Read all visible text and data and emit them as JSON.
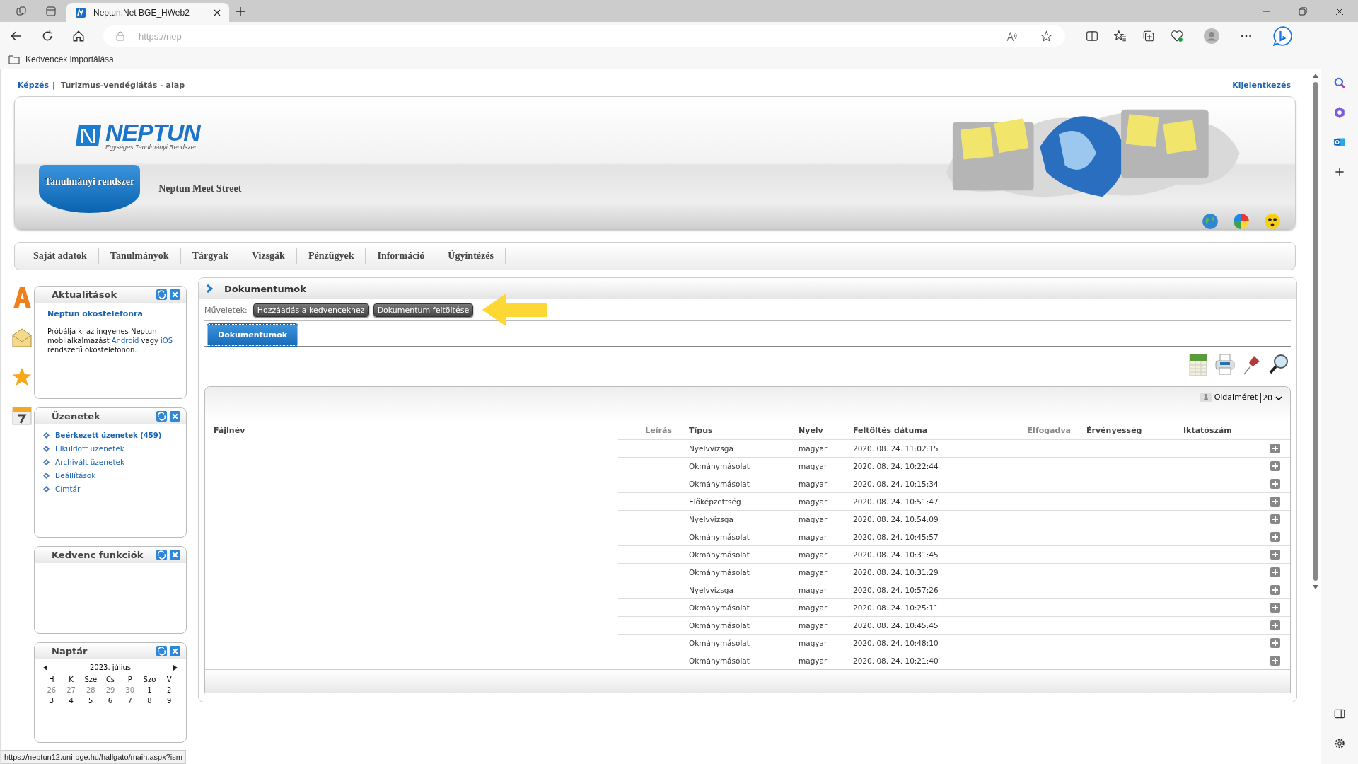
{
  "browser": {
    "tabs": [
      {
        "title": "Neptun.Net BGE_HWeb2",
        "selected": true
      }
    ],
    "url": "https://nep",
    "favorites": [
      "Kedvencek importálása"
    ],
    "status_url": "https://neptun12.uni-bge.hu/hallgato/main.aspx?ism"
  },
  "breadcrumb": {
    "label": "Képzés",
    "separator": "|",
    "program": "Turizmus-vendéglátás - alap"
  },
  "logout": "Kijelentkezés",
  "logo": {
    "name": "NEPTUN",
    "subtitle": "Egységes Tanulmányi Rendszer"
  },
  "system_tabs": [
    {
      "label": "Tanulmányi rendszer",
      "selected": true
    },
    {
      "label": "Neptun Meet Street",
      "selected": false
    }
  ],
  "menu": [
    "Saját adatok",
    "Tanulmányok",
    "Tárgyak",
    "Vizsgák",
    "Pénzügyek",
    "Információ",
    "Ügyintézés"
  ],
  "news": {
    "title": "Aktualitások",
    "headline": "Neptun okostelefonra",
    "parts": [
      {
        "kind": "text",
        "text": "Próbálja ki az ingyenes Neptun mobilalkalmazást "
      },
      {
        "kind": "link",
        "text": "Android"
      },
      {
        "kind": "text",
        "text": " vagy "
      },
      {
        "kind": "link",
        "text": "iOS"
      },
      {
        "kind": "text",
        "text": " rendszerű okostelefonon."
      }
    ]
  },
  "messages": {
    "title": "Üzenetek",
    "items": [
      {
        "label": "Beérkezett üzenetek (459)",
        "highlighted": true
      },
      {
        "label": "Elküldött üzenetek",
        "highlighted": false
      },
      {
        "label": "Archivált üzenetek",
        "highlighted": false
      },
      {
        "label": "Beállítások",
        "highlighted": false
      },
      {
        "label": "Címtár",
        "highlighted": false
      }
    ]
  },
  "favorite_functions": {
    "title": "Kedvenc funkciók"
  },
  "calendar": {
    "title": "Naptár",
    "month": "2023. július",
    "weekdays": [
      "H",
      "K",
      "Sze",
      "Cs",
      "P",
      "Szo",
      "V"
    ],
    "weeks": [
      [
        {
          "day": "26",
          "other_month": true
        },
        {
          "day": "27",
          "other_month": true
        },
        {
          "day": "28",
          "other_month": true
        },
        {
          "day": "29",
          "other_month": true
        },
        {
          "day": "30",
          "other_month": true
        },
        {
          "day": "1",
          "other_month": false
        },
        {
          "day": "2",
          "other_month": false
        }
      ],
      [
        {
          "day": "3",
          "other_month": false
        },
        {
          "day": "4",
          "other_month": false
        },
        {
          "day": "5",
          "other_month": false
        },
        {
          "day": "6",
          "other_month": false
        },
        {
          "day": "7",
          "other_month": false
        },
        {
          "day": "8",
          "other_month": false
        },
        {
          "day": "9",
          "other_month": false
        }
      ]
    ]
  },
  "documents": {
    "title": "Dokumentumok",
    "actions_label": "Műveletek:",
    "actions": [
      "Hozzáadás a kedvencekhez",
      "Dokumentum feltöltése"
    ],
    "tabs": [
      {
        "label": "Dokumentumok",
        "selected": true
      }
    ],
    "pager": {
      "page": "1",
      "size_label": "Oldalméret",
      "size": "20"
    },
    "columns": [
      {
        "label": "Fájlnév",
        "dimmed": false
      },
      {
        "label": "Leírás",
        "dimmed": true
      },
      {
        "label": "Típus",
        "dimmed": false
      },
      {
        "label": "Nyelv",
        "dimmed": false
      },
      {
        "label": "Feltöltés dátuma",
        "dimmed": false
      },
      {
        "label": "Elfogadva",
        "dimmed": true
      },
      {
        "label": "Érvényesség",
        "dimmed": false
      },
      {
        "label": "Iktatószám",
        "dimmed": false
      }
    ],
    "rows": [
      {
        "type": "Nyelvvizsga",
        "language": "magyar",
        "date": "2020. 08. 24. 11:02:15"
      },
      {
        "type": "Okmánymásolat",
        "language": "magyar",
        "date": "2020. 08. 24. 10:22:44"
      },
      {
        "type": "Okmánymásolat",
        "language": "magyar",
        "date": "2020. 08. 24. 10:15:34"
      },
      {
        "type": "Előképzettség",
        "language": "magyar",
        "date": "2020. 08. 24. 10:51:47"
      },
      {
        "type": "Nyelvvizsga",
        "language": "magyar",
        "date": "2020. 08. 24. 10:54:09"
      },
      {
        "type": "Okmánymásolat",
        "language": "magyar",
        "date": "2020. 08. 24. 10:45:57"
      },
      {
        "type": "Okmánymásolat",
        "language": "magyar",
        "date": "2020. 08. 24. 10:31:45"
      },
      {
        "type": "Okmánymásolat",
        "language": "magyar",
        "date": "2020. 08. 24. 10:31:29"
      },
      {
        "type": "Nyelvvizsga",
        "language": "magyar",
        "date": "2020. 08. 24. 10:57:26"
      },
      {
        "type": "Okmánymásolat",
        "language": "magyar",
        "date": "2020. 08. 24. 10:25:11"
      },
      {
        "type": "Okmánymásolat",
        "language": "magyar",
        "date": "2020. 08. 24. 10:45:45"
      },
      {
        "type": "Okmánymásolat",
        "language": "magyar",
        "date": "2020. 08. 24. 10:48:10"
      },
      {
        "type": "Okmánymásolat",
        "language": "magyar",
        "date": "2020. 08. 24. 10:21:40"
      }
    ]
  }
}
